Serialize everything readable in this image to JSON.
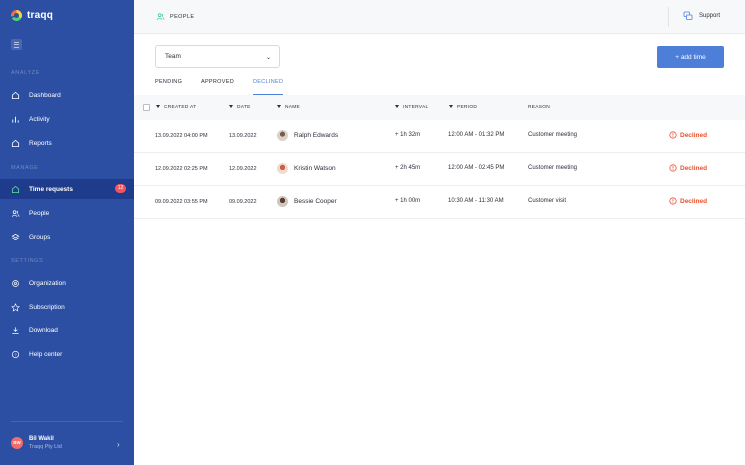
{
  "app": {
    "name": "traqq"
  },
  "sidebar": {
    "sections": {
      "analyze": "ANALYZE",
      "manage": "MANAGE",
      "settings": "SETTINGS"
    },
    "items": [
      {
        "label": "Dashboard",
        "icon": "home-icon"
      },
      {
        "label": "Activity",
        "icon": "bar-chart-icon"
      },
      {
        "label": "Reports",
        "icon": "home-icon"
      },
      {
        "label": "Time requests",
        "icon": "home-icon",
        "badge": "12",
        "active": true
      },
      {
        "label": "People",
        "icon": "people-icon"
      },
      {
        "label": "Groups",
        "icon": "layers-icon"
      },
      {
        "label": "Organization",
        "icon": "gear-icon"
      },
      {
        "label": "Subscription",
        "icon": "star-icon"
      },
      {
        "label": "Download",
        "icon": "download-icon"
      },
      {
        "label": "Help center",
        "icon": "help-icon"
      }
    ],
    "user": {
      "initials": "BW",
      "name": "Bil Wakil",
      "company": "Traqq Pty Ltd"
    }
  },
  "topbar": {
    "breadcrumb": "PEOPLE",
    "support": "Support"
  },
  "filter": {
    "team": "Team"
  },
  "actions": {
    "add_time": "+ add time"
  },
  "tabs": [
    "PENDING",
    "APPROVED",
    "DECLINED"
  ],
  "active_tab": "DECLINED",
  "table": {
    "columns": [
      "CREATED AT",
      "DATE",
      "NAME",
      "INTERVAL",
      "PERIOD",
      "REASON"
    ],
    "rows": [
      {
        "created_at": "13.09.2022 04:00 PM",
        "date": "13.09.2022",
        "name": "Ralph Edwards",
        "interval": "+ 1h 32m",
        "period": "12:00 AM - 01:32 PM",
        "reason": "Customer meeting",
        "status": "Declined"
      },
      {
        "created_at": "12.09.2022 02:25 PM",
        "date": "12.09.2022",
        "name": "Kristin Watson",
        "interval": "+ 2h 45m",
        "period": "12:00 AM - 02:45 PM",
        "reason": "Customer meeting",
        "status": "Declined"
      },
      {
        "created_at": "09.09.2022 03:55 PM",
        "date": "09.09.2022",
        "name": "Bessie Cooper",
        "interval": "+ 1h 00m",
        "period": "10:30 AM - 11:30 AM",
        "reason": "Customer visit",
        "status": "Declined"
      }
    ]
  },
  "colors": {
    "sidebar": "#2c4fa3",
    "accent": "#4d7ed8",
    "declined": "#e8512f",
    "badge": "#f25561"
  }
}
